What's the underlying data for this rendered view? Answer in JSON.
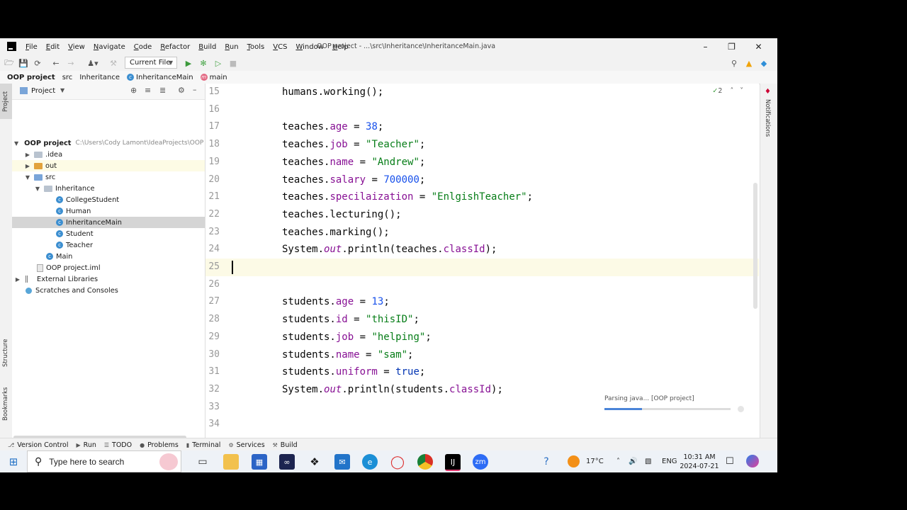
{
  "window": {
    "title": "OOP project - ...\\src\\Inheritance\\InheritanceMain.java",
    "menu": [
      "File",
      "Edit",
      "View",
      "Navigate",
      "Code",
      "Refactor",
      "Build",
      "Run",
      "Tools",
      "VCS",
      "Window",
      "Help"
    ]
  },
  "toolbar": {
    "run_config": "Current File"
  },
  "breadcrumbs": [
    "OOP project",
    "src",
    "Inheritance",
    "InheritanceMain",
    "main"
  ],
  "left_strip": {
    "project": "Project",
    "structure": "Structure",
    "bookmarks": "Bookmarks"
  },
  "right_strip": {
    "notifications": "Notifications"
  },
  "project_panel": {
    "title": "Project",
    "tree": [
      {
        "label": "OOP project",
        "path": "C:\\Users\\Cody Lamont\\IdeaProjects\\OOP p"
      },
      {
        "label": ".idea"
      },
      {
        "label": "out"
      },
      {
        "label": "src"
      },
      {
        "label": "Inheritance"
      },
      {
        "label": "CollegeStudent"
      },
      {
        "label": "Human"
      },
      {
        "label": "InheritanceMain"
      },
      {
        "label": "Student"
      },
      {
        "label": "Teacher"
      },
      {
        "label": "Main"
      },
      {
        "label": "OOP project.iml"
      },
      {
        "label": "External Libraries"
      },
      {
        "label": "Scratches and Consoles"
      }
    ]
  },
  "editor": {
    "inspection_count": "2",
    "lines": [
      {
        "n": "15",
        "code": "humans.working();"
      },
      {
        "n": "16",
        "code": ""
      },
      {
        "n": "17",
        "code": "teaches.age = 38;"
      },
      {
        "n": "18",
        "code": "teaches.job = \"Teacher\";"
      },
      {
        "n": "19",
        "code": "teaches.name = \"Andrew\";"
      },
      {
        "n": "20",
        "code": "teaches.salary = 700000;"
      },
      {
        "n": "21",
        "code": "teaches.specilaization = \"EnlgishTeacher\";"
      },
      {
        "n": "22",
        "code": "teaches.lecturing();"
      },
      {
        "n": "23",
        "code": "teaches.marking();"
      },
      {
        "n": "24",
        "code": "System.out.println(teaches.classId);"
      },
      {
        "n": "25",
        "code": ""
      },
      {
        "n": "26",
        "code": ""
      },
      {
        "n": "27",
        "code": "students.age = 13;"
      },
      {
        "n": "28",
        "code": "students.id = \"thisID\";"
      },
      {
        "n": "29",
        "code": "students.job = \"helping\";"
      },
      {
        "n": "30",
        "code": "students.name = \"sam\";"
      },
      {
        "n": "31",
        "code": "students.uniform = true;"
      },
      {
        "n": "32",
        "code": "System.out.println(students.classId);"
      },
      {
        "n": "33",
        "code": ""
      },
      {
        "n": "34",
        "code": ""
      }
    ],
    "background_task": "Parsing java... [OOP project]",
    "background_progress": 0.3
  },
  "bottom_tools": [
    "Version Control",
    "Run",
    "TODO",
    "Problems",
    "Terminal",
    "Services",
    "Build"
  ],
  "taskbar": {
    "search_placeholder": "Type here to search",
    "weather": "17°C",
    "language": "ENG",
    "time": "10:31 AM",
    "date": "2024-07-21"
  }
}
